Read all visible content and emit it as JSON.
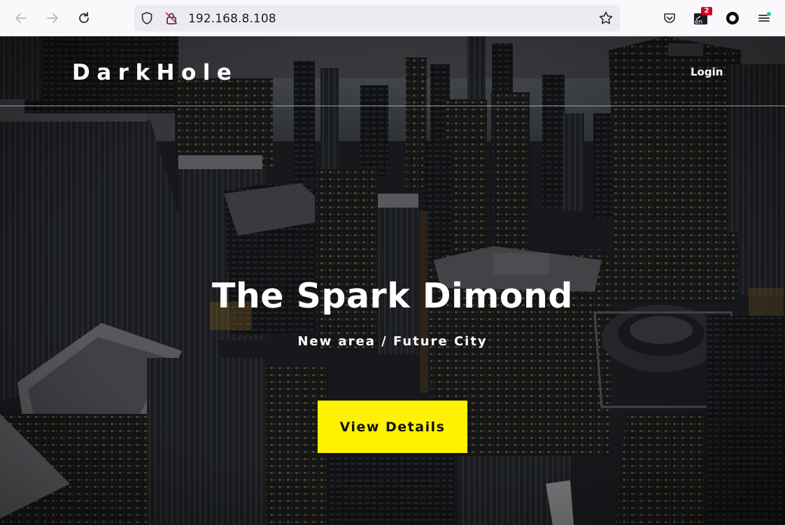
{
  "browser": {
    "url": "192.168.8.108",
    "icons": [
      "back-arrow-icon",
      "forward-arrow-icon",
      "reload-icon",
      "tracking-shield-icon",
      "insecure-lock-icon",
      "bookmark-star-icon",
      "pocket-icon",
      "language-extension-icon",
      "extension-circle-icon",
      "menu-icon"
    ],
    "extension_badge": "2",
    "extension_label": "en"
  },
  "site": {
    "brand": "DarkHole",
    "nav_login": "Login",
    "headline": "The Spark Dimond",
    "subheadline": "New area / Future City",
    "cta_label": "View Details",
    "accent_color": "#fff200"
  }
}
